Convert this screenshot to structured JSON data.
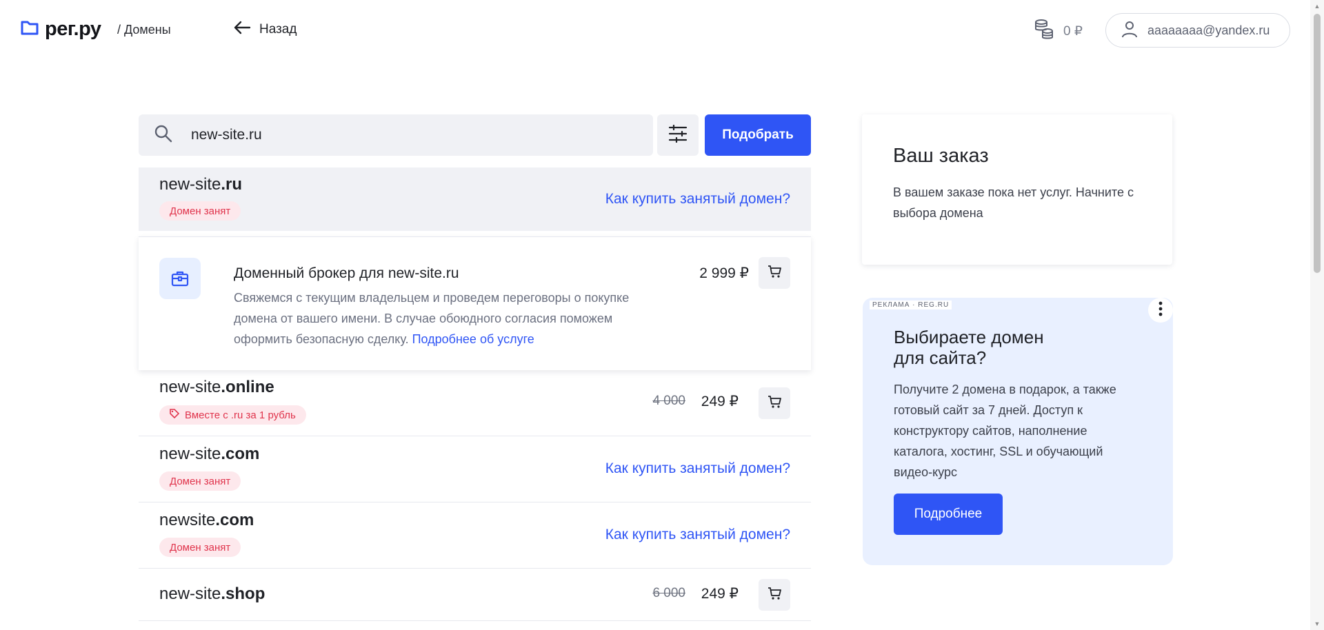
{
  "header": {
    "logo_text": "рег.ру",
    "breadcrumb": "/ Домены",
    "back_label": "Назад",
    "balance": "0 ₽",
    "user_email": "aaaaaaaa@yandex.ru"
  },
  "search": {
    "value": "new-site.ru",
    "submit_label": "Подобрать"
  },
  "results": [
    {
      "name": "new-site",
      "zone": ".ru",
      "status": "taken",
      "badge": "Домен занят",
      "link": "Как купить занятый домен?"
    },
    {
      "name": "new-site",
      "zone": ".online",
      "status": "available",
      "badge": "Вместе с .ru за 1 рубль",
      "old_price": "4 000",
      "price": "249 ₽"
    },
    {
      "name": "new-site",
      "zone": ".com",
      "status": "taken",
      "badge": "Домен занят",
      "link": "Как купить занятый домен?"
    },
    {
      "name": "newsite",
      "zone": ".com",
      "status": "taken",
      "badge": "Домен занят",
      "link": "Как купить занятый домен?"
    },
    {
      "name": "new-site",
      "zone": ".shop",
      "status": "available",
      "old_price": "6 000",
      "price": "249 ₽"
    }
  ],
  "broker": {
    "title": "Доменный брокер для new-site.ru",
    "description": "Свяжемся с текущим владельцем и проведем переговоры о покупке домена от вашего имени. В случае обоюдного согласия поможем оформить безопасную сделку.",
    "link": "Подробнее об услуге",
    "price": "2 999 ₽"
  },
  "order": {
    "title": "Ваш заказ",
    "text": "В вашем заказе пока нет услуг. Начните с выбора домена"
  },
  "ad": {
    "label": "РЕКЛАМА · REG.RU",
    "title_line1": "Выбираете домен",
    "title_line2": "для сайта?",
    "text": "Получите 2 домена в подарок, а также готовый сайт за 7 дней. Доступ к конструктору сайтов, наполнение каталога, хостинг, SSL и обучающий видео-курс",
    "button": "Подробнее"
  },
  "colors": {
    "accent": "#2f55f5",
    "taken_badge_bg": "#fde8ec",
    "taken_badge_text": "#e0344c",
    "ad_bg": "#e9f0ff"
  }
}
